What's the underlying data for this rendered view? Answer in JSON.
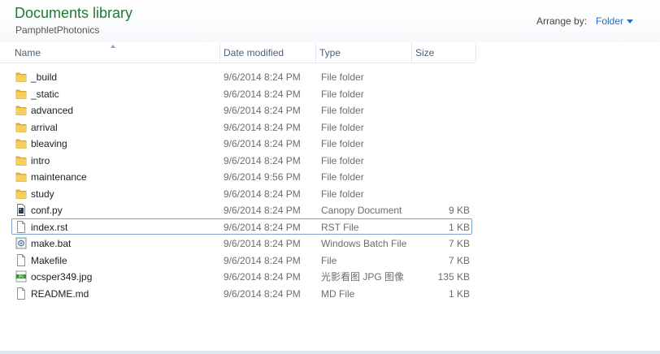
{
  "library": {
    "title": "Documents library",
    "subtitle": "PamphletPhotonics",
    "arrange_label": "Arrange by:",
    "arrange_value": "Folder"
  },
  "columns": {
    "name": "Name",
    "date": "Date modified",
    "type": "Type",
    "size": "Size"
  },
  "files": [
    {
      "name": "_build",
      "date": "9/6/2014 8:24 PM",
      "type": "File folder",
      "size": "",
      "icon": "folder-icon"
    },
    {
      "name": "_static",
      "date": "9/6/2014 8:24 PM",
      "type": "File folder",
      "size": "",
      "icon": "folder-icon"
    },
    {
      "name": "advanced",
      "date": "9/6/2014 8:24 PM",
      "type": "File folder",
      "size": "",
      "icon": "folder-icon"
    },
    {
      "name": "arrival",
      "date": "9/6/2014 8:24 PM",
      "type": "File folder",
      "size": "",
      "icon": "folder-icon"
    },
    {
      "name": "bleaving",
      "date": "9/6/2014 8:24 PM",
      "type": "File folder",
      "size": "",
      "icon": "folder-icon"
    },
    {
      "name": "intro",
      "date": "9/6/2014 8:24 PM",
      "type": "File folder",
      "size": "",
      "icon": "folder-icon"
    },
    {
      "name": "maintenance",
      "date": "9/6/2014 9:56 PM",
      "type": "File folder",
      "size": "",
      "icon": "folder-icon"
    },
    {
      "name": "study",
      "date": "9/6/2014 8:24 PM",
      "type": "File folder",
      "size": "",
      "icon": "folder-icon"
    },
    {
      "name": "conf.py",
      "date": "9/6/2014 8:24 PM",
      "type": "Canopy Document",
      "size": "9 KB",
      "icon": "python-file-icon"
    },
    {
      "name": "index.rst",
      "date": "9/6/2014 8:24 PM",
      "type": "RST File",
      "size": "1 KB",
      "icon": "blank-file-icon"
    },
    {
      "name": "make.bat",
      "date": "9/6/2014 8:24 PM",
      "type": "Windows Batch File",
      "size": "7 KB",
      "icon": "batch-file-icon"
    },
    {
      "name": "Makefile",
      "date": "9/6/2014 8:24 PM",
      "type": "File",
      "size": "7 KB",
      "icon": "blank-file-icon"
    },
    {
      "name": "ocsper349.jpg",
      "date": "9/6/2014 8:24 PM",
      "type": "光影看图 JPG 图像",
      "size": "135 KB",
      "icon": "image-file-icon"
    },
    {
      "name": "README.md",
      "date": "9/6/2014 8:24 PM",
      "type": "MD File",
      "size": "1 KB",
      "icon": "blank-file-icon"
    }
  ],
  "focused_row": 9,
  "colors": {
    "title_green": "#1e7b34",
    "link_blue": "#2a6bbd",
    "focus_border": "#7da2ce",
    "folder_yellow": "#e8b83a"
  }
}
